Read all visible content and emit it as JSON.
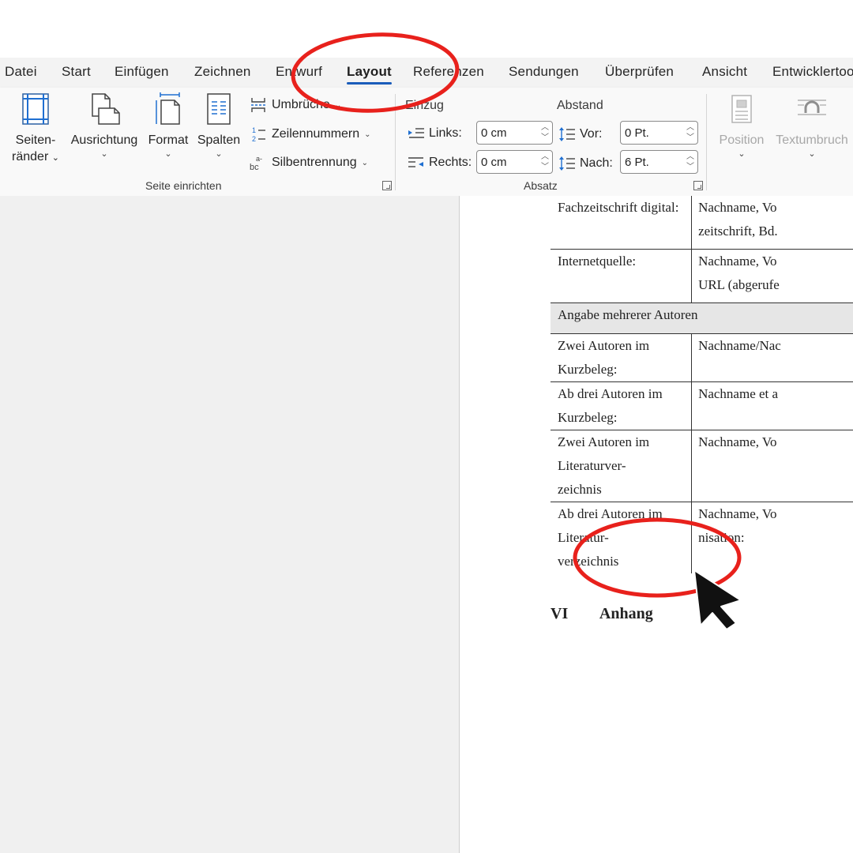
{
  "tabs": [
    {
      "label": "Datei",
      "active": false
    },
    {
      "label": "Start",
      "active": false
    },
    {
      "label": "Einfügen",
      "active": false
    },
    {
      "label": "Zeichnen",
      "active": false
    },
    {
      "label": "Entwurf",
      "active": false
    },
    {
      "label": "Layout",
      "active": true
    },
    {
      "label": "Referenzen",
      "active": false
    },
    {
      "label": "Sendungen",
      "active": false
    },
    {
      "label": "Überprüfen",
      "active": false
    },
    {
      "label": "Ansicht",
      "active": false
    },
    {
      "label": "Entwicklertools",
      "active": false
    }
  ],
  "ribbon": {
    "seite_einrichten": {
      "label": "Seite einrichten",
      "margins": {
        "line1": "Seiten-",
        "line2": "ränder",
        "chevron": "⌄"
      },
      "orientation": {
        "label": "Ausrichtung",
        "chevron": "⌄"
      },
      "size": {
        "label": "Format",
        "chevron": "⌄"
      },
      "columns": {
        "label": "Spalten",
        "chevron": "⌄"
      },
      "breaks": {
        "label": "Umbrüche",
        "chevron": "⌄"
      },
      "line_numbers": {
        "label": "Zeilennummern",
        "chevron": "⌄"
      },
      "hyphenation": {
        "label": "Silbentrennung",
        "chevron": "⌄"
      }
    },
    "absatz": {
      "label": "Absatz",
      "indent": {
        "caption": "Einzug",
        "left_label": "Links:",
        "left_value": "0 cm",
        "right_label": "Rechts:",
        "right_value": "0 cm"
      },
      "spacing": {
        "caption": "Abstand",
        "before_label": "Vor:",
        "before_value": "0 Pt.",
        "after_label": "Nach:",
        "after_value": "6 Pt."
      }
    },
    "anordnen": {
      "position": {
        "label": "Position",
        "chevron": "⌄"
      },
      "wrap": {
        "label": "Textumbruch",
        "chevron": "⌄"
      }
    }
  },
  "document": {
    "table": [
      {
        "c1": [
          "Fachzeitschrift digital:"
        ],
        "c2": [
          "Nachname, Vo",
          "zeitschrift, Bd."
        ],
        "head": false
      },
      {
        "c1": [
          "Internetquelle:"
        ],
        "c2": [
          "Nachname, Vo",
          "URL (abgerufe"
        ],
        "head": false
      },
      {
        "c1": [
          "Angabe mehrerer Autoren"
        ],
        "c2": [],
        "head": true
      },
      {
        "c1": [
          "Zwei Autoren im Kurzbeleg:"
        ],
        "c2": [
          "Nachname/Nac"
        ],
        "head": false
      },
      {
        "c1": [
          "Ab drei Autoren im Kurzbeleg:"
        ],
        "c2": [
          "Nachname et a"
        ],
        "head": false
      },
      {
        "c1": [
          "Zwei Autoren im Literaturver-",
          "zeichnis"
        ],
        "c2": [
          "Nachname, Vo",
          ""
        ],
        "head": false
      },
      {
        "c1": [
          "Ab drei Autoren im Literatur-",
          "verzeichnis"
        ],
        "c2": [
          "Nachname, Vo",
          "nisation:"
        ],
        "head": false
      }
    ],
    "heading": {
      "number": "VI",
      "title": "Anhang"
    }
  },
  "annotations": {
    "circle_color": "#e8211c",
    "cursor_color": "#111111"
  }
}
